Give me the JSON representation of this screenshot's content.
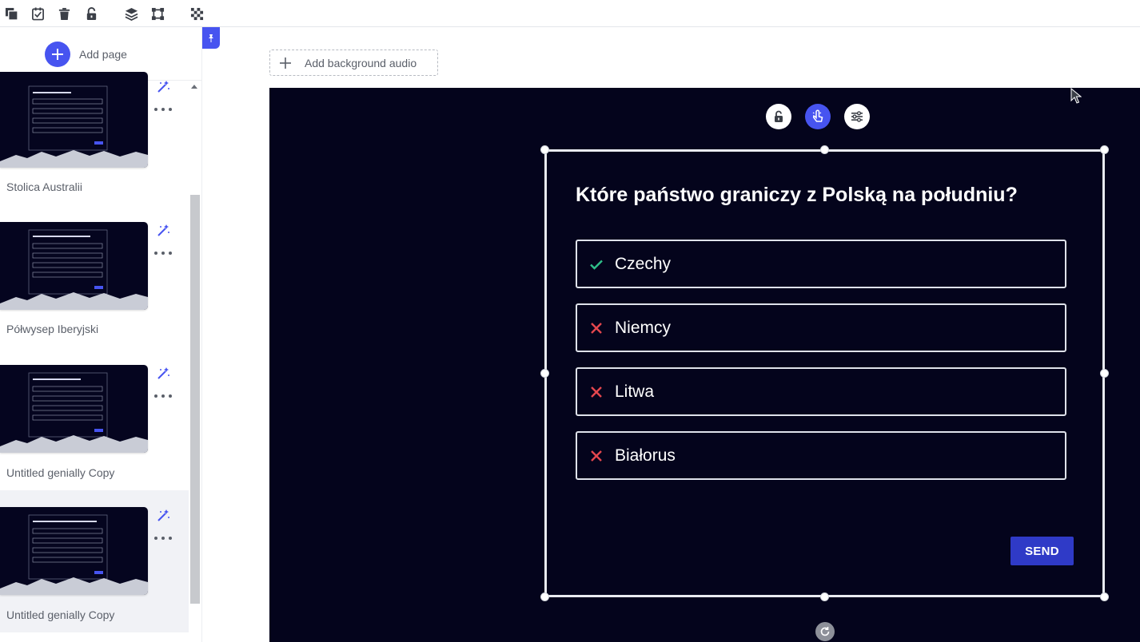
{
  "toolbar": {
    "icons": [
      "duplicate-icon",
      "checklist-icon",
      "trash-icon",
      "unlock-icon",
      "layers-icon",
      "group-icon",
      "transparency-icon"
    ]
  },
  "sidebar": {
    "add_page_label": "Add page",
    "pages": [
      {
        "label": "Stolica Australii"
      },
      {
        "label": "Półwysep Iberyjski"
      },
      {
        "label": "Untitled genially Copy"
      },
      {
        "label": "Untitled genially Copy"
      }
    ]
  },
  "canvas": {
    "add_audio_label": "Add background audio",
    "question": "Które państwo graniczy z Polską na południu?",
    "options": [
      {
        "text": "Czechy",
        "correct": true
      },
      {
        "text": "Niemcy",
        "correct": false
      },
      {
        "text": "Litwa",
        "correct": false
      },
      {
        "text": "Białorus",
        "correct": false
      }
    ],
    "send_label": "SEND"
  },
  "colors": {
    "accent": "#4754f0",
    "slide_bg": "#04041c",
    "correct": "#2fbf8a",
    "wrong": "#e4474e",
    "send_bg": "#2f3ac7"
  }
}
